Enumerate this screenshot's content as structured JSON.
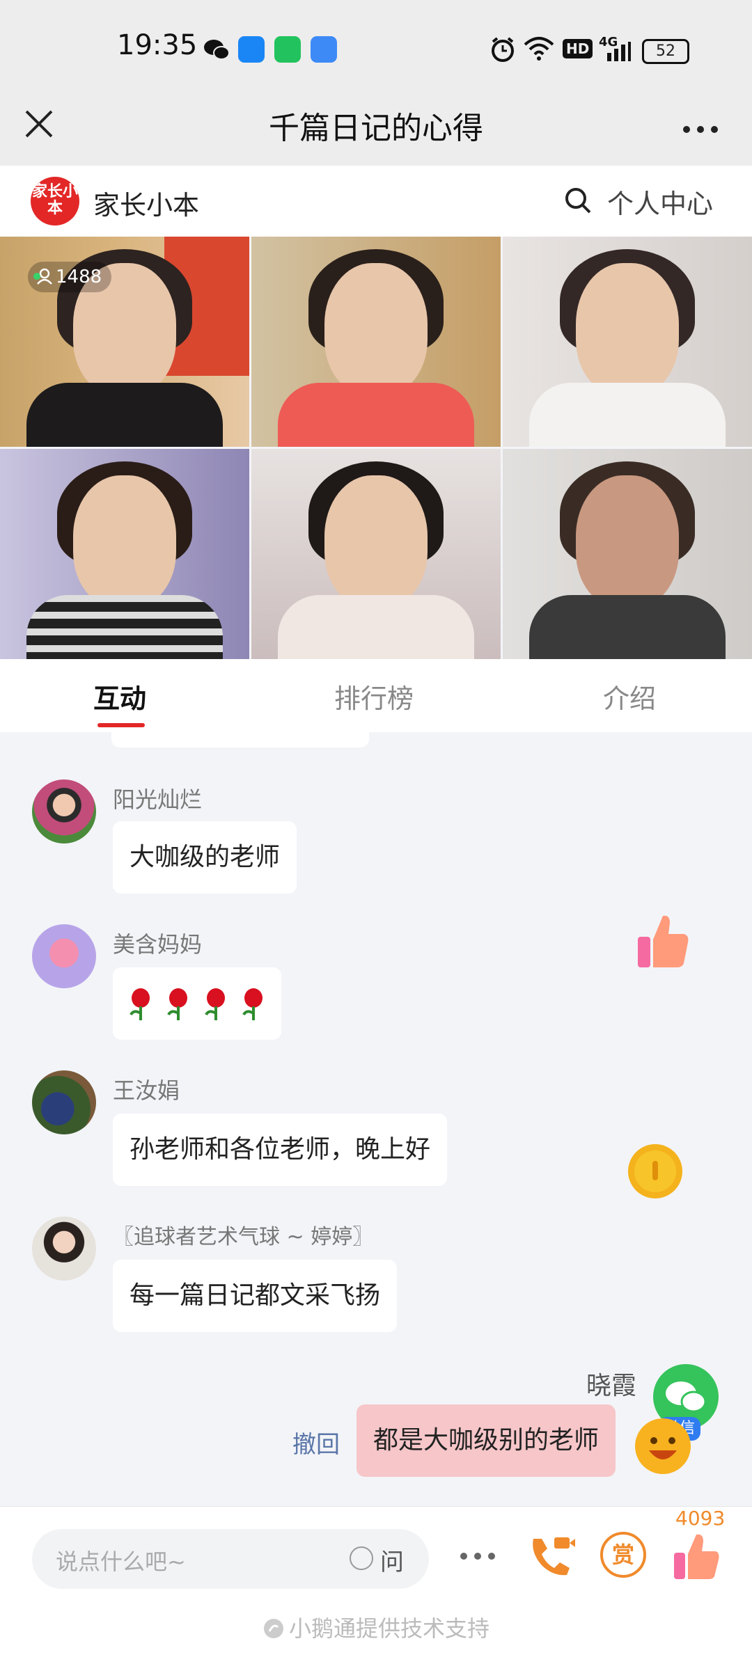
{
  "status_bar": {
    "time": "19:35",
    "network": "4G",
    "hd": "HD",
    "battery": "52"
  },
  "title_bar": {
    "title": "千篇日记的心得"
  },
  "brand": {
    "logo_text": "家长小本",
    "name": "家长小本",
    "user_center": "个人中心"
  },
  "live": {
    "viewer_count": "1488"
  },
  "tabs": [
    {
      "label": "互动",
      "active": true
    },
    {
      "label": "排行榜",
      "active": false
    },
    {
      "label": "介绍",
      "active": false
    }
  ],
  "messages": [
    {
      "name": "阳光灿烂",
      "text": "大咖级的老师"
    },
    {
      "name": "美含妈妈",
      "text": "",
      "emoji": "rose-x4"
    },
    {
      "name": "王汝娟",
      "text": "孙老师和各位老师，晚上好"
    },
    {
      "name": "〖追球者艺术气球 ~ 婷婷〗",
      "text": "每一篇日记都文采飞扬"
    }
  ],
  "my_message": {
    "name": "晓霞",
    "text": "都是大咖级别的老师",
    "recall_label": "撤回",
    "wechat_label": "微信"
  },
  "bottom_bar": {
    "placeholder": "说点什么吧~",
    "ask_label": "问",
    "reward_label": "赏",
    "like_count": "4093",
    "powered_by": "小鹅通提供技术支持"
  },
  "colors": {
    "accent": "#e32727",
    "my_bubble": "#f6c6c9",
    "reward": "#f08a2b"
  }
}
